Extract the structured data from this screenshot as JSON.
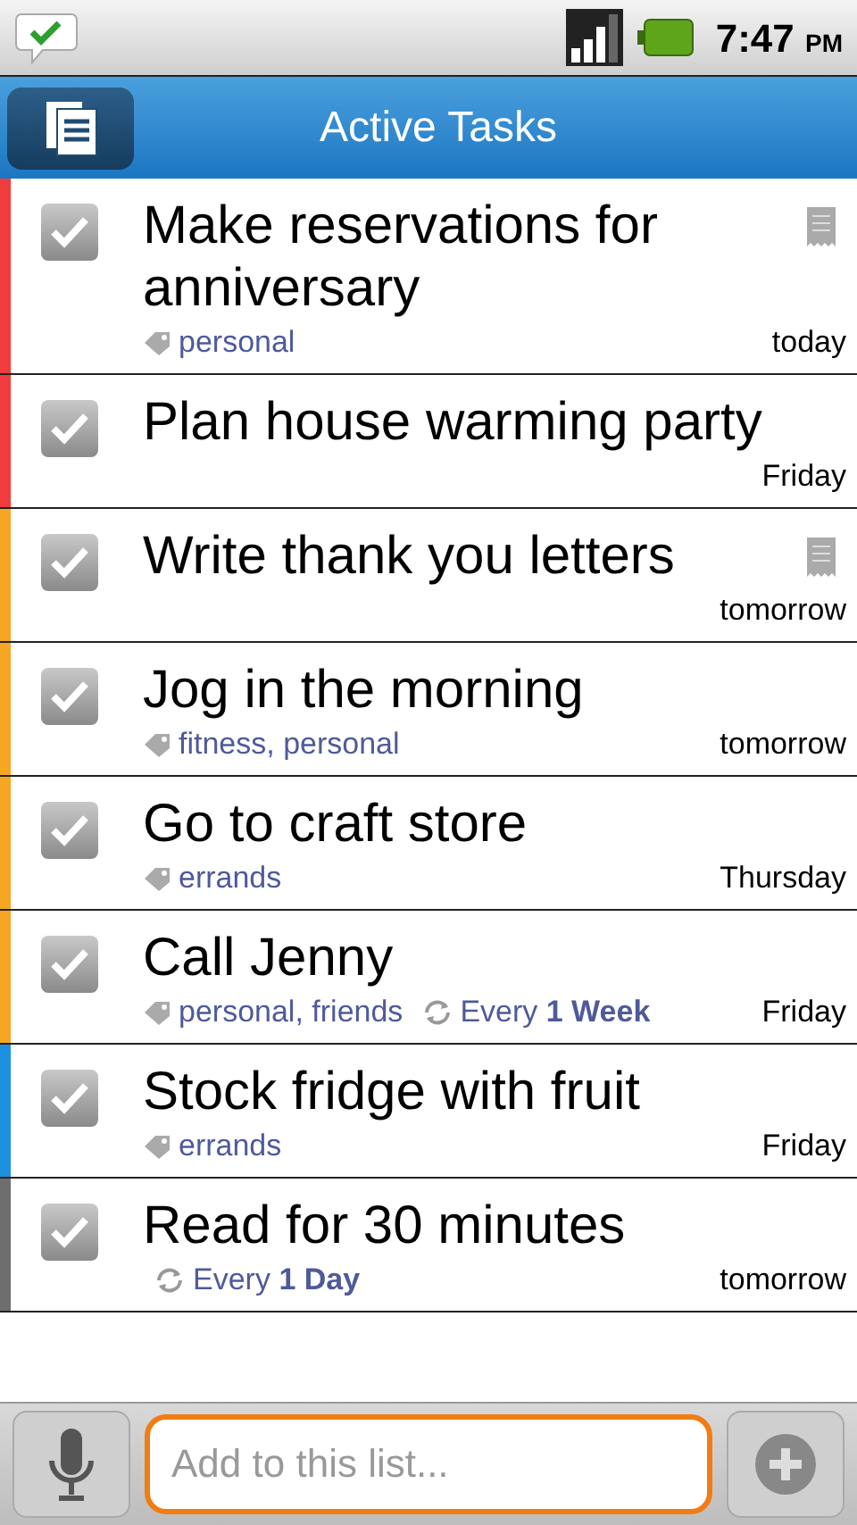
{
  "status_bar": {
    "time": "7:47",
    "ampm": "PM"
  },
  "header": {
    "title": "Active Tasks"
  },
  "tasks": [
    {
      "title": "Make reservations for anniversary",
      "color": "#f03c3c",
      "has_note": true,
      "completed": false,
      "tags": "personal",
      "due": "today"
    },
    {
      "title": "Plan house warming party",
      "color": "#f03c3c",
      "has_note": false,
      "completed": false,
      "due": "Friday"
    },
    {
      "title": "Write thank you letters",
      "color": "#f5a623",
      "has_note": true,
      "completed": false,
      "due": "tomorrow"
    },
    {
      "title": "Jog in the morning",
      "color": "#f5a623",
      "has_note": false,
      "completed": false,
      "tags": "fitness, personal",
      "due": "tomorrow"
    },
    {
      "title": "Go to craft store",
      "color": "#f5a623",
      "has_note": false,
      "completed": false,
      "tags": "errands",
      "due": "Thursday"
    },
    {
      "title": "Call Jenny",
      "color": "#f5a623",
      "has_note": false,
      "completed": false,
      "tags": "personal, friends",
      "repeat": "Every **1 Week**",
      "due": "Friday"
    },
    {
      "title": "Stock fridge with fruit",
      "color": "#1e90e0",
      "has_note": false,
      "completed": false,
      "tags": "errands",
      "due": "Friday"
    },
    {
      "title": "Read for 30 minutes",
      "color": "#6e6e6e",
      "has_note": false,
      "completed": false,
      "repeat": "Every **1 Day**",
      "due": "tomorrow"
    }
  ],
  "add_field": {
    "placeholder": "Add to this list..."
  }
}
